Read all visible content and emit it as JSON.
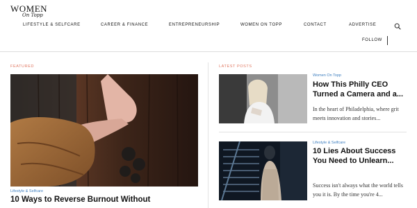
{
  "brand": {
    "name": "WOMEN",
    "tagline": "On Topp"
  },
  "nav": {
    "items": [
      {
        "label": "LIFESTYLE & SELFCARE"
      },
      {
        "label": "CAREER & FINANCE"
      },
      {
        "label": "ENTREPRENEURSHIP"
      },
      {
        "label": "WOMEN ON TOPP"
      },
      {
        "label": "CONTACT"
      },
      {
        "label": "ADVERTISE"
      }
    ],
    "search_icon": "search-icon",
    "follow_label": "FOLLOW"
  },
  "featured": {
    "section_label": "FEATURED",
    "category": "Lifestyle & Selfcare",
    "title": "10 Ways to Reverse Burnout Without"
  },
  "latest": {
    "section_label": "LATEST POSTS",
    "posts": [
      {
        "category": "Women On Topp",
        "title": "How This Philly CEO Turned a Camera and a...",
        "excerpt": "In the heart of Philadelphia, where grit meets innovation and stories..."
      },
      {
        "category": "Lifestyle & Selfcare",
        "title": "10 Lies About Success You Need to Unlearn...",
        "excerpt": "Success isn't always what the world tells you it is. By the time you're 4..."
      }
    ]
  },
  "colors": {
    "accent": "#e07862",
    "category_link": "#3f7fbf",
    "text": "#111111",
    "divider": "#e2e2e2"
  }
}
